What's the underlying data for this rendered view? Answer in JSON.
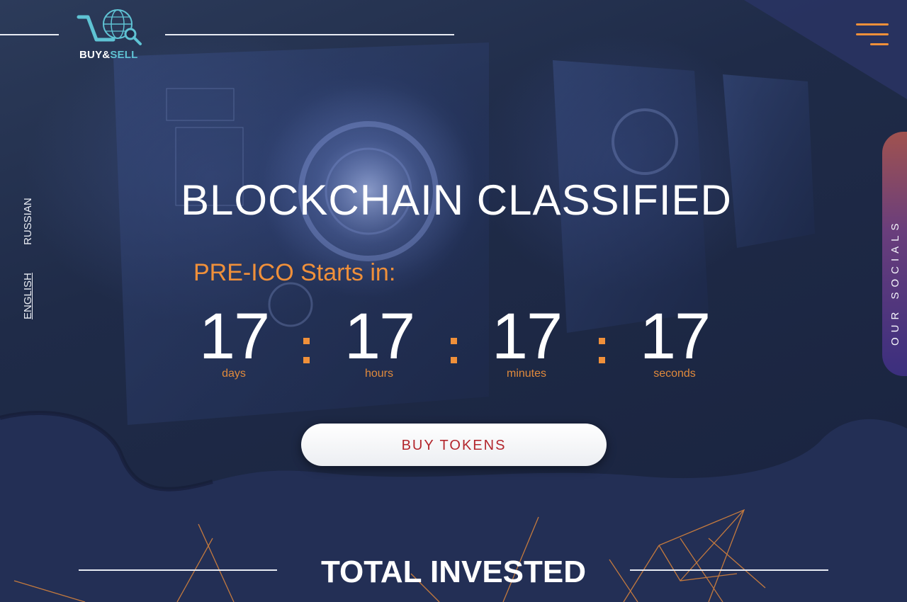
{
  "brand": {
    "logo_text_buy": "BUY&",
    "logo_text_sell": "SELL",
    "icon": "cart-globe-search-icon"
  },
  "header": {
    "menu_icon": "hamburger-menu-icon",
    "accent_color": "#f0903a"
  },
  "languages": [
    {
      "label": "RUSSIAN",
      "active": false
    },
    {
      "label": "ENGLISH",
      "active": true
    }
  ],
  "socials": {
    "label": "OUR SOCIALS"
  },
  "hero": {
    "title": "BLOCKCHAIN CLASSIFIED",
    "subtitle": "PRE-ICO Starts in:",
    "countdown": [
      {
        "value": "17",
        "label": "days"
      },
      {
        "value": "17",
        "label": "hours"
      },
      {
        "value": "17",
        "label": "minutes"
      },
      {
        "value": "17",
        "label": "seconds"
      }
    ],
    "cta_label": "BUY TOKENS",
    "cta_color": "#b3262d"
  },
  "sections": {
    "total_invested_title": "TOTAL INVESTED"
  }
}
